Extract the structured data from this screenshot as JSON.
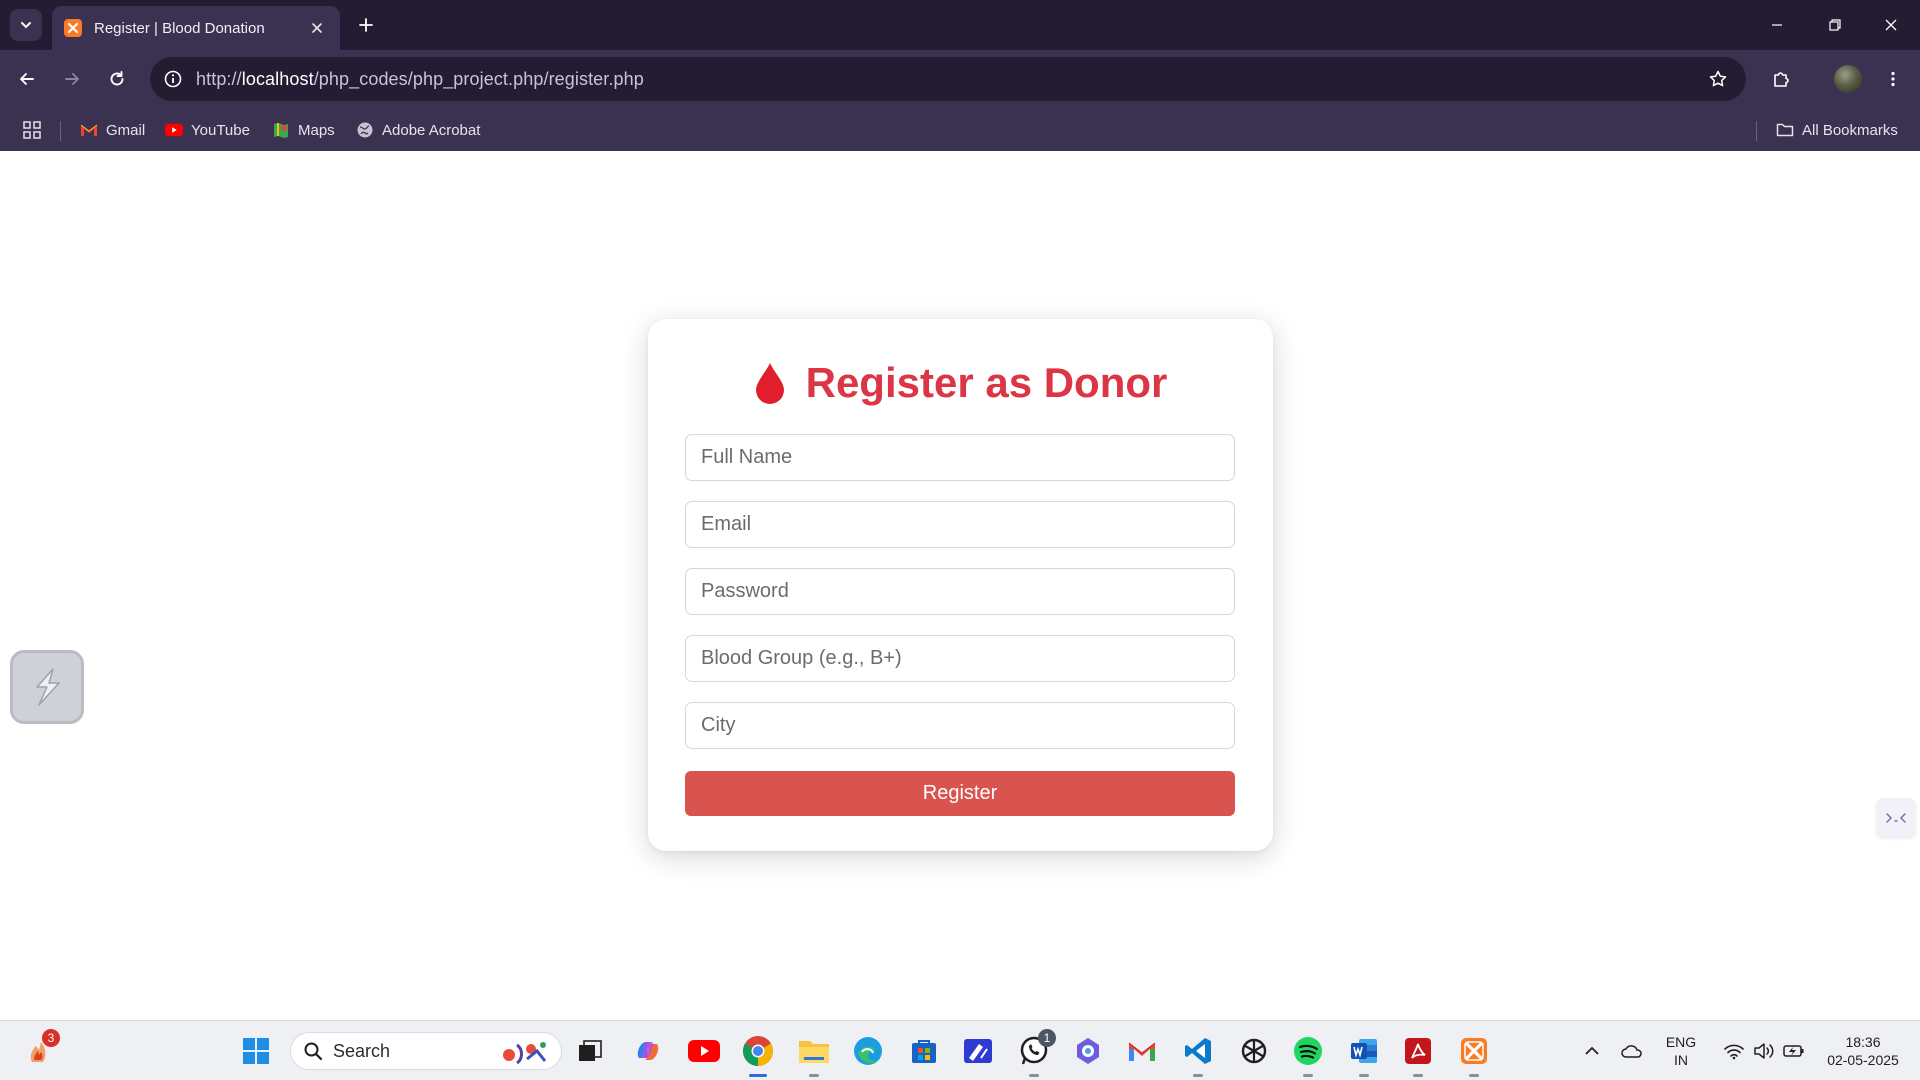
{
  "browser": {
    "tab": {
      "title": "Register | Blood Donation"
    },
    "omnibox": {
      "url_prefix": "http://",
      "url_host": "localhost",
      "url_path": "/php_codes/php_project.php/register.php"
    },
    "bookmarks": [
      {
        "label": "Gmail",
        "icon": "gmail-icon"
      },
      {
        "label": "YouTube",
        "icon": "youtube-icon"
      },
      {
        "label": "Maps",
        "icon": "maps-icon"
      },
      {
        "label": "Adobe Acrobat",
        "icon": "globe-icon"
      }
    ],
    "all_bookmarks_label": "All Bookmarks"
  },
  "form": {
    "title": "Register as Donor",
    "title_icon": "blood-drop-icon",
    "fields": {
      "full_name": {
        "placeholder": "Full Name"
      },
      "email": {
        "placeholder": "Email"
      },
      "password": {
        "placeholder": "Password"
      },
      "blood_group": {
        "placeholder": "Blood Group (e.g., B+)"
      },
      "city": {
        "placeholder": "City"
      }
    },
    "submit_label": "Register"
  },
  "colors": {
    "brand_red": "#dc3545",
    "button_red": "#d9534f",
    "chrome_dark": "#241c33",
    "chrome_mid": "#3b3150"
  },
  "taskbar": {
    "search_label": "Search",
    "widgets_badge": "3",
    "whatsapp_badge": "1",
    "language_line1": "ENG",
    "language_line2": "IN",
    "time": "18:36",
    "date": "02-05-2025"
  }
}
